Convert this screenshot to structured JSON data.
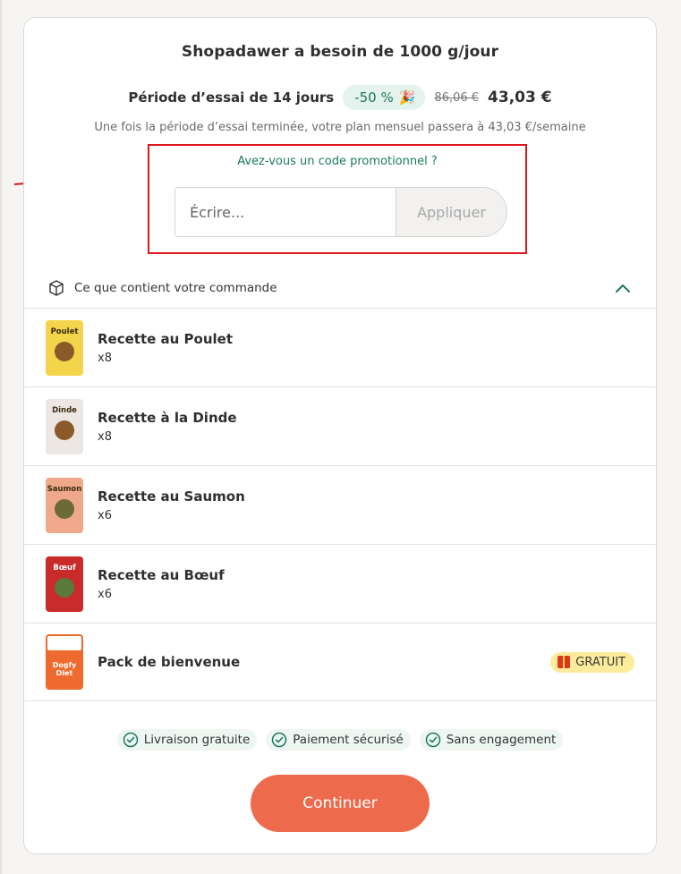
{
  "header": {
    "title": "Shopadawer a besoin de 1000 g/jour",
    "trial_label": "Période d’essai de 14 jours",
    "discount": "-50 %",
    "discount_icon": "party-popper-icon",
    "old_price": "86,06 €",
    "new_price": "43,03 €",
    "subnote": "Une fois la période d’essai terminée, votre plan mensuel passera à 43,03 €/semaine"
  },
  "promo": {
    "link": "Avez-vous un code promotionnel ?",
    "placeholder": "Écrire...",
    "apply_label": "Appliquer"
  },
  "order": {
    "title": "Ce que contient votre commande",
    "items": [
      {
        "name": "Recette au Poulet",
        "qty": "x8",
        "pack_label": "Poulet",
        "color": "#f3d44a"
      },
      {
        "name": "Recette à la Dinde",
        "qty": "x8",
        "pack_label": "Dinde",
        "color": "#ece7e2"
      },
      {
        "name": "Recette au Saumon",
        "qty": "x6",
        "pack_label": "Saumon",
        "color": "#f0a88a"
      },
      {
        "name": "Recette au Bœuf",
        "qty": "x6",
        "pack_label": "Bœuf",
        "color": "#c92a2a"
      },
      {
        "name": "Pack de bienvenue",
        "qty": "",
        "pack_label": "Dogfy Diet",
        "color": "#ee6a2e",
        "badge": "GRATUIT"
      }
    ]
  },
  "trust": [
    "Livraison gratuite",
    "Paiement sécurisé",
    "Sans engagement"
  ],
  "cta": {
    "label": "Continuer"
  },
  "colors": {
    "accent": "#ee6a4c",
    "green": "#1a7a5b",
    "highlight": "#e0141b"
  }
}
